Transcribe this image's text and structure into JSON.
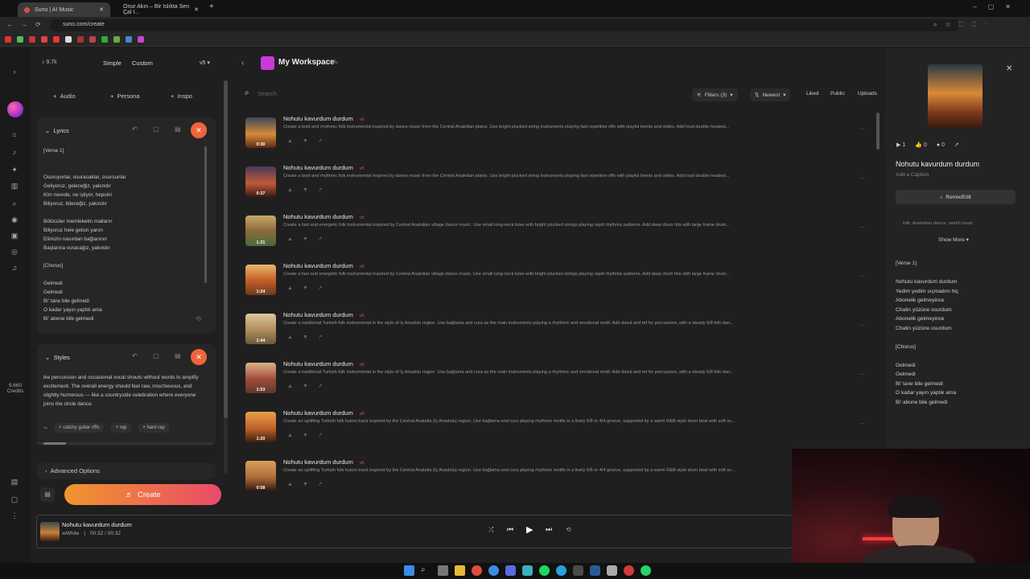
{
  "browser": {
    "tabs": [
      {
        "label": "Suno | AI Music"
      },
      {
        "label": "Onur Akın – Bir Islıkta Sen Çal I..."
      }
    ],
    "url": "suno.com/create"
  },
  "topbar": {
    "count": "9.7k",
    "mode_simple": "Simple",
    "mode_custom": "Custom",
    "version": "v5",
    "workspace": "My Workspace",
    "search_placeholder": "Search",
    "filters": "Filters (3)",
    "sort": "Newest",
    "liked": "Liked",
    "public": "Public",
    "uploads": "Uploads"
  },
  "rail": {
    "credits_value": "9,660",
    "credits_label": "Credits"
  },
  "left": {
    "audio": "Audio",
    "persona": "Persona",
    "inspo": "Inspo",
    "lyrics_title": "Lyrics",
    "lyrics": [
      "[Verse 1]",
      "",
      "",
      "Osuruyorlar, osuracaklar, osursunlar",
      "Geliyoruz, geleceğiz, yakındır",
      "Kim nerede, ne işliyor, hepsini",
      "Biliyoruz, bileceğiz, yakındır",
      "",
      "Bölücüler memleketin malların",
      "Biliyoruz hele gelsin yanın",
      "Elimizin nasırdan bağlarının",
      "Başlarına vuracağız, yakındır",
      "",
      "[Chorus]",
      "",
      "Gelmedi",
      "Gelmedi",
      "Bi' tane bile gelmedi",
      "O kadar yayın yaptık ama",
      "Bi' abone bile gelmedi"
    ],
    "styles_title": "Styles",
    "styles_text": "ike percussion and occasional vocal shouts without words to amplify excitement. The overall energy should feel raw, mischievous, and slightly humorous — like a countryside celebration where everyone joins the circle dance.",
    "tags": [
      "catchy guitar riffs",
      "rap",
      "hard rap"
    ],
    "advanced": "Advanced Options",
    "create": "Create"
  },
  "songs": [
    {
      "title": "Nohutu kavurdum durdum",
      "badge": "v5",
      "duration": "0:30",
      "desc": "Create a bold and rhythmic folk instrumental inspired by dance music from the Central Anatolian plains. Use bright plucked string instruments playing fast repetitive riffs with playful bends and slides. Add loud double-headed..."
    },
    {
      "title": "Nohutu kavurdum durdum",
      "badge": "v5",
      "duration": "0:37",
      "desc": "Create a bold and rhythmic folk instrumental inspired by dance music from the Central Anatolian plains. Use bright plucked string instruments playing fast repetitive riffs with playful bends and slides. Add loud double-headed..."
    },
    {
      "title": "Nohutu kavurdum durdum",
      "badge": "v5",
      "duration": "1:21",
      "desc": "Create a fast and energetic folk instrumental inspired by Central Anatolian village dance music. Use small long-neck lutes with bright plucked strings playing rapid rhythmic patterns. Add deep drum hits with large frame drum..."
    },
    {
      "title": "Nohutu kavurdum durdum",
      "badge": "v5",
      "duration": "1:24",
      "desc": "Create a fast and energetic folk instrumental inspired by Central Anatolian village dance music. Use small long-neck lutes with bright plucked strings playing rapid rhythmic patterns. Add deep drum hits with large frame drum..."
    },
    {
      "title": "Nohutu kavurdum durdum",
      "badge": "v5",
      "duration": "1:44",
      "desc": "Create a traditional Turkish folk instrumental in the style of İç Anadolu region. Use bağlama and cura as the main instruments playing a rhythmic and emotional motif. Add davul and tef for percussion, with a steady 6/8 folk dan..."
    },
    {
      "title": "Nohutu kavurdum durdum",
      "badge": "v5",
      "duration": "1:53",
      "desc": "Create a traditional Turkish folk instrumental in the style of İç Anadolu region. Use bağlama and cura as the main instruments playing a rhythmic and emotional motif. Add davul and tef for percussion, with a steady 6/8 folk dan..."
    },
    {
      "title": "Nohutu kavurdum durdum",
      "badge": "v5",
      "duration": "1:20",
      "desc": "Create an uplifting Turkish folk fusion track inspired by the Central Anatolia (İç Anadolu) region. Use bağlama and cura playing rhythmic motifs in a lively 6/8 or 4/4 groove, supported by a warm R&B-style drum beat with soft sn..."
    },
    {
      "title": "Nohutu kavurdum durdum",
      "badge": "v5",
      "duration": "0:58",
      "desc": "Create an uplifting Turkish folk fusion track inspired by the Central Anatolia (İç Anadolu) region. Use bağlama and cura playing rhythmic motifs in a lively 6/8 or 4/4 groove, supported by a warm R&B-style drum beat with soft sn..."
    }
  ],
  "detail": {
    "plays": "1",
    "likes": "0",
    "comments": "0",
    "title": "Nohutu kavurdum durdum",
    "caption": "Add a Caption",
    "remix": "Remix/Edit",
    "tags": "folk, Anatolian dance, world music",
    "show_more": "Show More",
    "lyrics": [
      "[Verse 1]",
      "",
      "Nohutu kavurdum durdum",
      "Yedim yedim sıçmadım hiç",
      "Abonelik gelmeyince",
      "Chatin yüzüne osurdum",
      "Abonelik gelmeyince",
      "Chatin yüzüne osurdum",
      "",
      "[Chorus]",
      "",
      "Gelmedi",
      "Gelmedi",
      "Bi' tane bile gelmedi",
      "O kadar yayın yaptık ama",
      "Bi' abone bile gelmedi"
    ]
  },
  "player": {
    "title": "Nohutu kavurdum durdum",
    "artist": "wWhite",
    "time": "00:32 / 00:32"
  },
  "colors": {
    "accent": "#f0643c",
    "badge": "#e6467a",
    "workspace": "#c93ad8"
  }
}
